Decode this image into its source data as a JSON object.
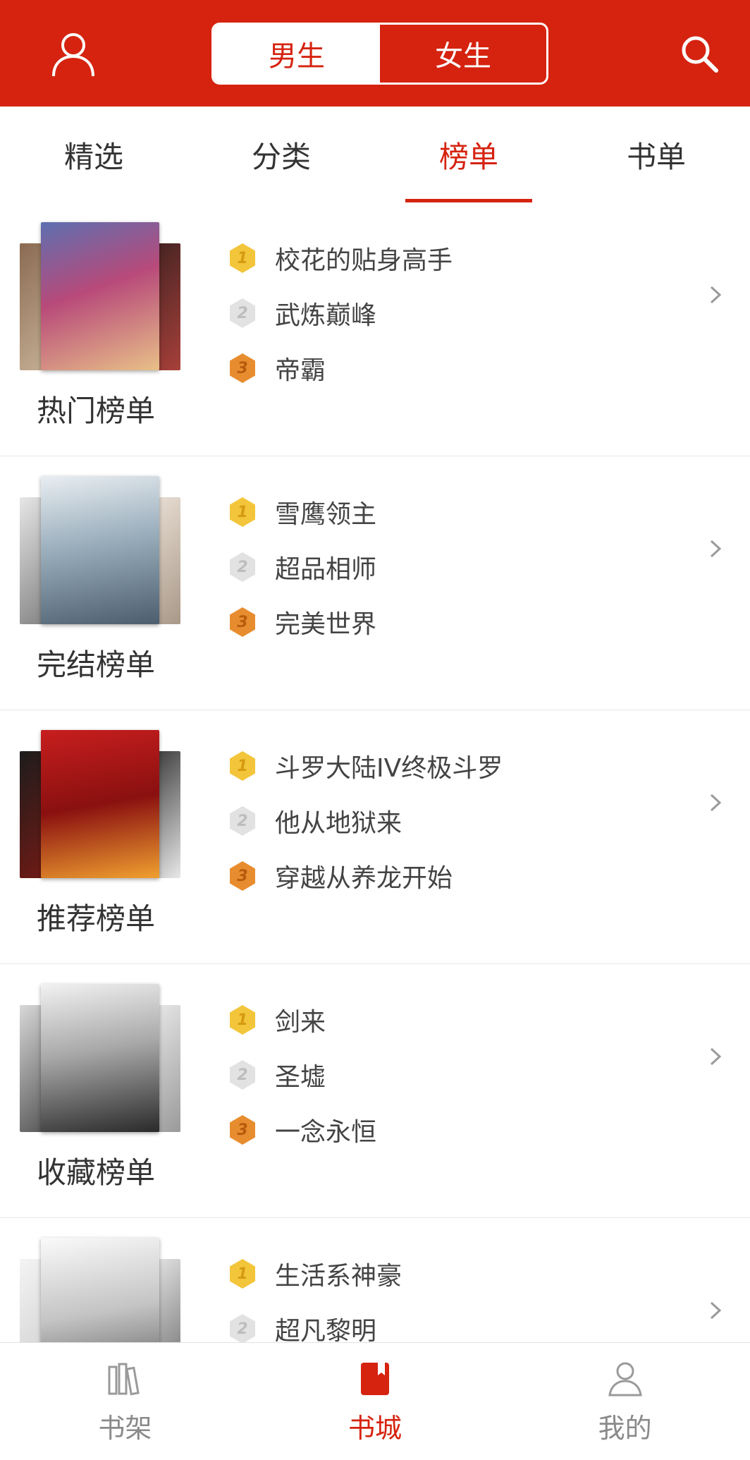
{
  "colors": {
    "accent": "#d5230f",
    "medal_gold": "#f3c53a",
    "medal_silver": "#e2e2e2",
    "medal_bronze": "#e88d2f"
  },
  "header": {
    "user_icon": "user-icon",
    "search_icon": "search-icon",
    "gender": {
      "male": "男生",
      "female": "女生",
      "selected": "男生"
    }
  },
  "tabs": [
    {
      "label": "精选"
    },
    {
      "label": "分类"
    },
    {
      "label": "榜单",
      "active": true
    },
    {
      "label": "书单"
    }
  ],
  "rankings": [
    {
      "title": "热门榜单",
      "books": [
        "校花的贴身高手",
        "武炼巅峰",
        "帝霸"
      ]
    },
    {
      "title": "完结榜单",
      "books": [
        "雪鹰领主",
        "超品相师",
        "完美世界"
      ]
    },
    {
      "title": "推荐榜单",
      "books": [
        "斗罗大陆IV终极斗罗",
        "他从地狱来",
        "穿越从养龙开始"
      ]
    },
    {
      "title": "收藏榜单",
      "books": [
        "剑来",
        "圣墟",
        "一念永恒"
      ]
    },
    {
      "title": "",
      "books": [
        "生活系神豪",
        "超凡黎明",
        ""
      ]
    }
  ],
  "medals": [
    "1",
    "2",
    "3"
  ],
  "bottom_nav": [
    {
      "label": "书架",
      "icon": "bookshelf-icon"
    },
    {
      "label": "书城",
      "icon": "bookstore-icon",
      "active": true
    },
    {
      "label": "我的",
      "icon": "profile-icon"
    }
  ]
}
